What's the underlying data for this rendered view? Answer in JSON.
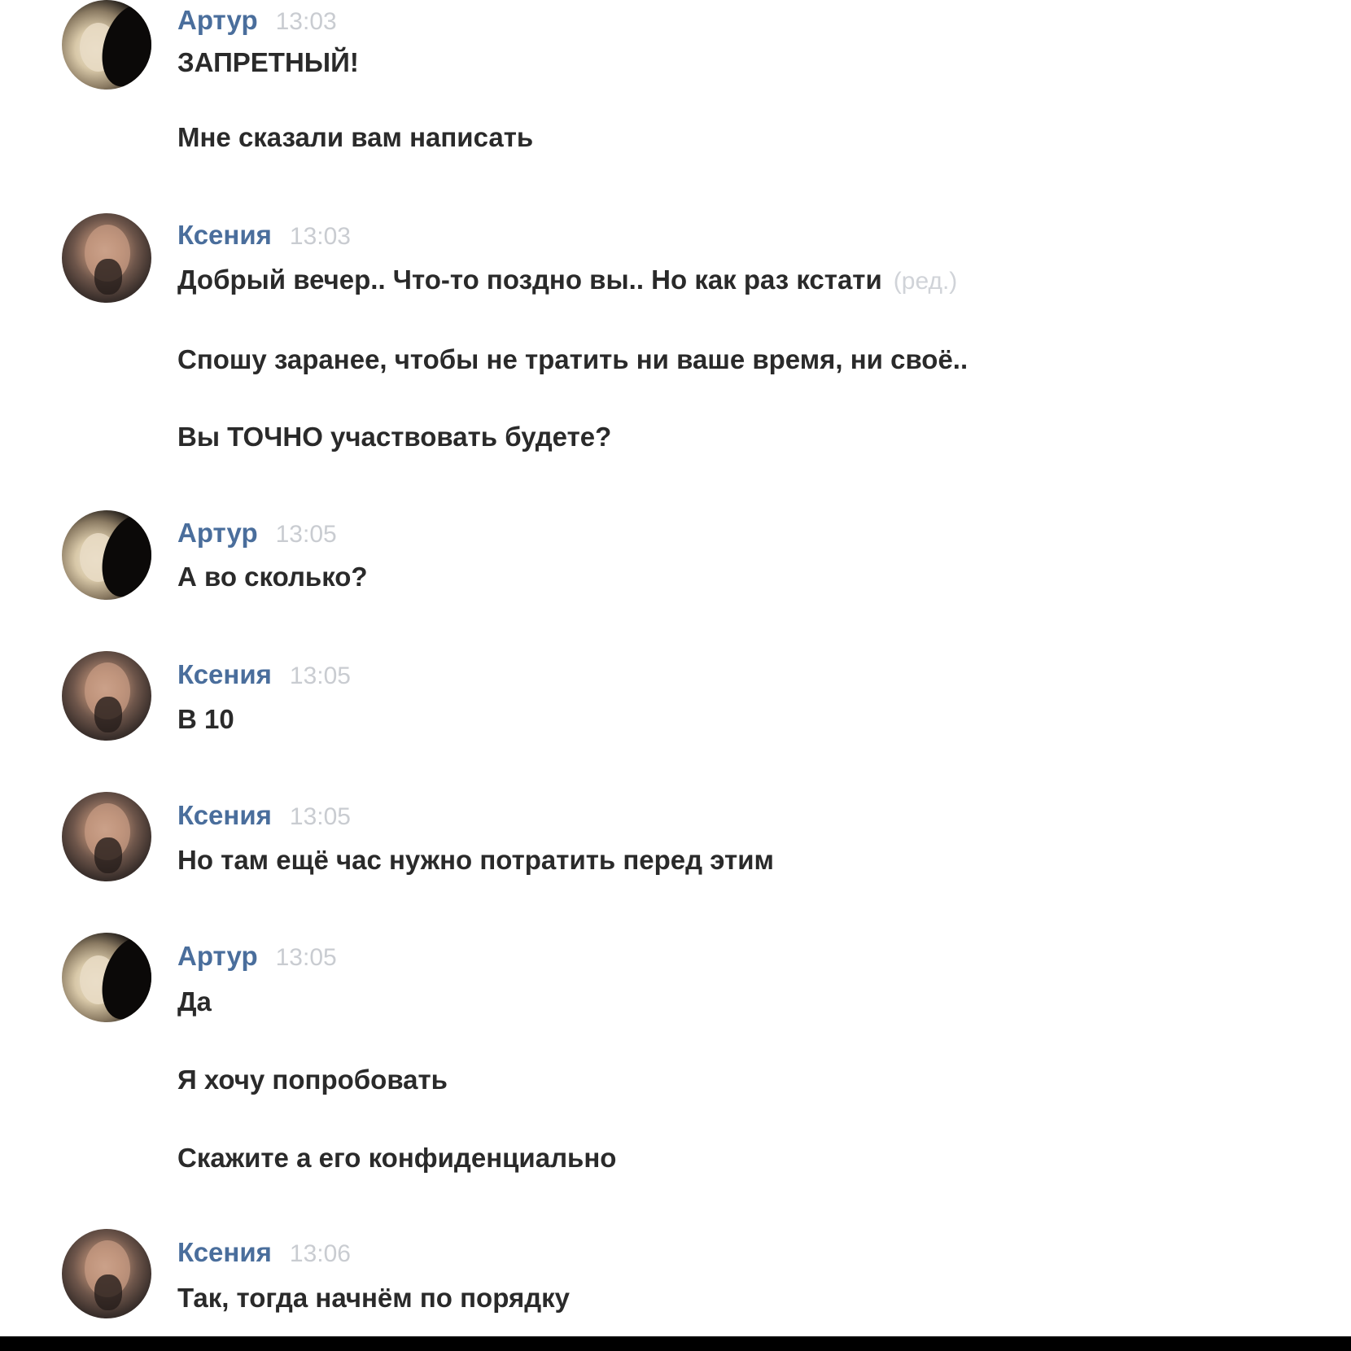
{
  "messages": [
    {
      "author": "Артур",
      "time": "13:03",
      "lines": [
        "ЗАПРЕТНЫЙ!",
        "Мне сказали вам написать"
      ]
    },
    {
      "author": "Ксения",
      "time": "13:03",
      "lines": [
        "Добрый вечер.. Что-то поздно вы.. Но как раз кстати",
        "Спошу заранее, чтобы не тратить ни ваше время, ни своё..",
        "Вы ТОЧНО участвовать будете?"
      ],
      "edited_label": "(ред.)"
    },
    {
      "author": "Артур",
      "time": "13:05",
      "lines": [
        "А во сколько?"
      ]
    },
    {
      "author": "Ксения",
      "time": "13:05",
      "lines": [
        "В 10"
      ]
    },
    {
      "author": "Ксения",
      "time": "13:05",
      "lines": [
        "Но там ещё час нужно потратить перед этим"
      ]
    },
    {
      "author": "Артур",
      "time": "13:05",
      "lines": [
        "Да",
        "Я хочу попробовать",
        "Скажите а его конфиденциально"
      ]
    },
    {
      "author": "Ксения",
      "time": "13:06",
      "lines": [
        "Так, тогда начнём по порядку"
      ]
    }
  ],
  "colors": {
    "author_link": "#4a6e9c",
    "timestamp": "#c9ccd1",
    "message_text": "#2a2a2a",
    "background": "#ffffff"
  },
  "icons": {
    "artur_avatar": "user-avatar-photo",
    "ksenia_avatar": "user-avatar-photo"
  }
}
